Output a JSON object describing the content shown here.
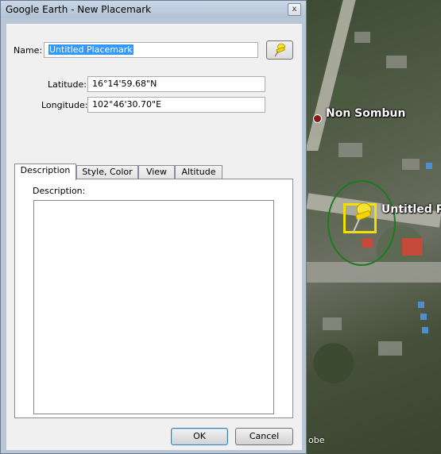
{
  "window": {
    "title": "Google Earth - New Placemark",
    "close_glyph": "x"
  },
  "form": {
    "name_label": "Name:",
    "name_value": "Untitled Placemark",
    "pin_icon": "yellow-pushpin-icon",
    "latitude_label": "Latitude:",
    "latitude_value": "16°14'59.68\"N",
    "longitude_label": "Longitude:",
    "longitude_value": "102°46'30.70\"E"
  },
  "tabs": [
    {
      "label": "Description",
      "active": true
    },
    {
      "label": "Style, Color",
      "active": false
    },
    {
      "label": "View",
      "active": false
    },
    {
      "label": "Altitude",
      "active": false
    }
  ],
  "description_panel": {
    "label": "Description:",
    "value": ""
  },
  "buttons": {
    "ok": "OK",
    "cancel": "Cancel"
  },
  "map": {
    "place_label": "Non Sombun",
    "placemark_label": "Untitled P",
    "credit_text": "obe",
    "colors": {
      "pin_highlight": "#f2e100",
      "selection_ring": "#1d7a1d",
      "place_dot": "#8a1a1a"
    }
  }
}
